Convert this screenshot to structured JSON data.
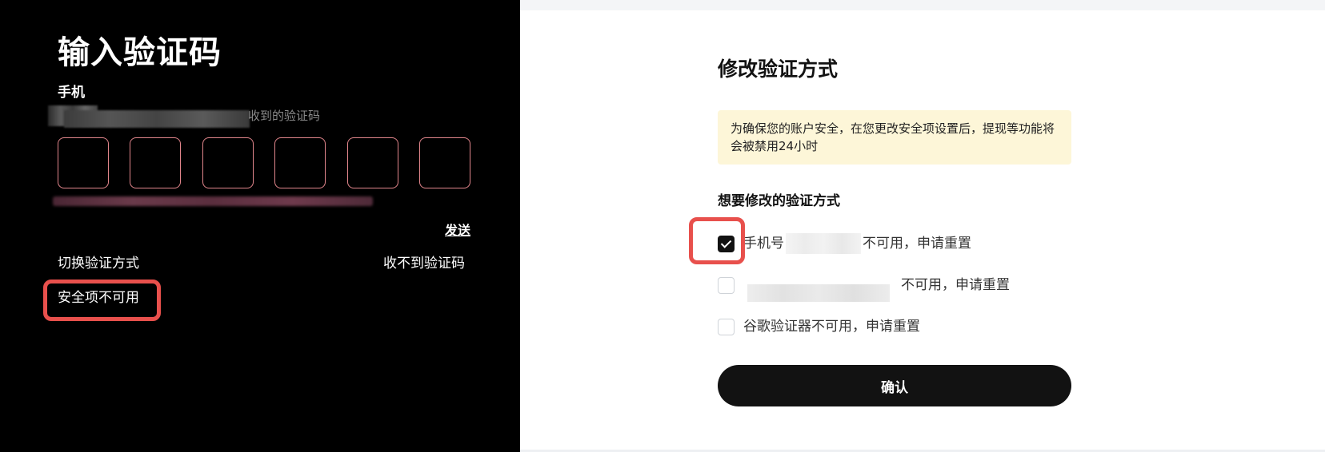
{
  "left_panel": {
    "title": "输入验证码",
    "label": "手机",
    "description_suffix": "收到的验证码",
    "code_box_count": 6,
    "send_link": "发送",
    "switch_method": "切换验证方式",
    "no_code_received": "收不到验证码",
    "security_unavailable": "安全项不可用"
  },
  "right_panel": {
    "title": "修改验证方式",
    "notice": "为确保您的账户安全，在您更改安全项设置后，提现等功能将会被禁用24小时",
    "subtitle": "想要修改的验证方式",
    "options": [
      {
        "prefix": "手机号",
        "suffix": "不可用，申请重置",
        "checked": true
      },
      {
        "prefix": "",
        "suffix": "不可用，申请重置",
        "checked": false
      },
      {
        "prefix": "谷歌验证器不可用，申请重置",
        "suffix": "",
        "checked": false
      }
    ],
    "confirm_button": "确认"
  },
  "colors": {
    "left_bg": "#000000",
    "code_box_border": "#e2868c",
    "notice_bg": "#fdf6d8",
    "primary_button": "#121212",
    "highlight": "#e8504c"
  }
}
